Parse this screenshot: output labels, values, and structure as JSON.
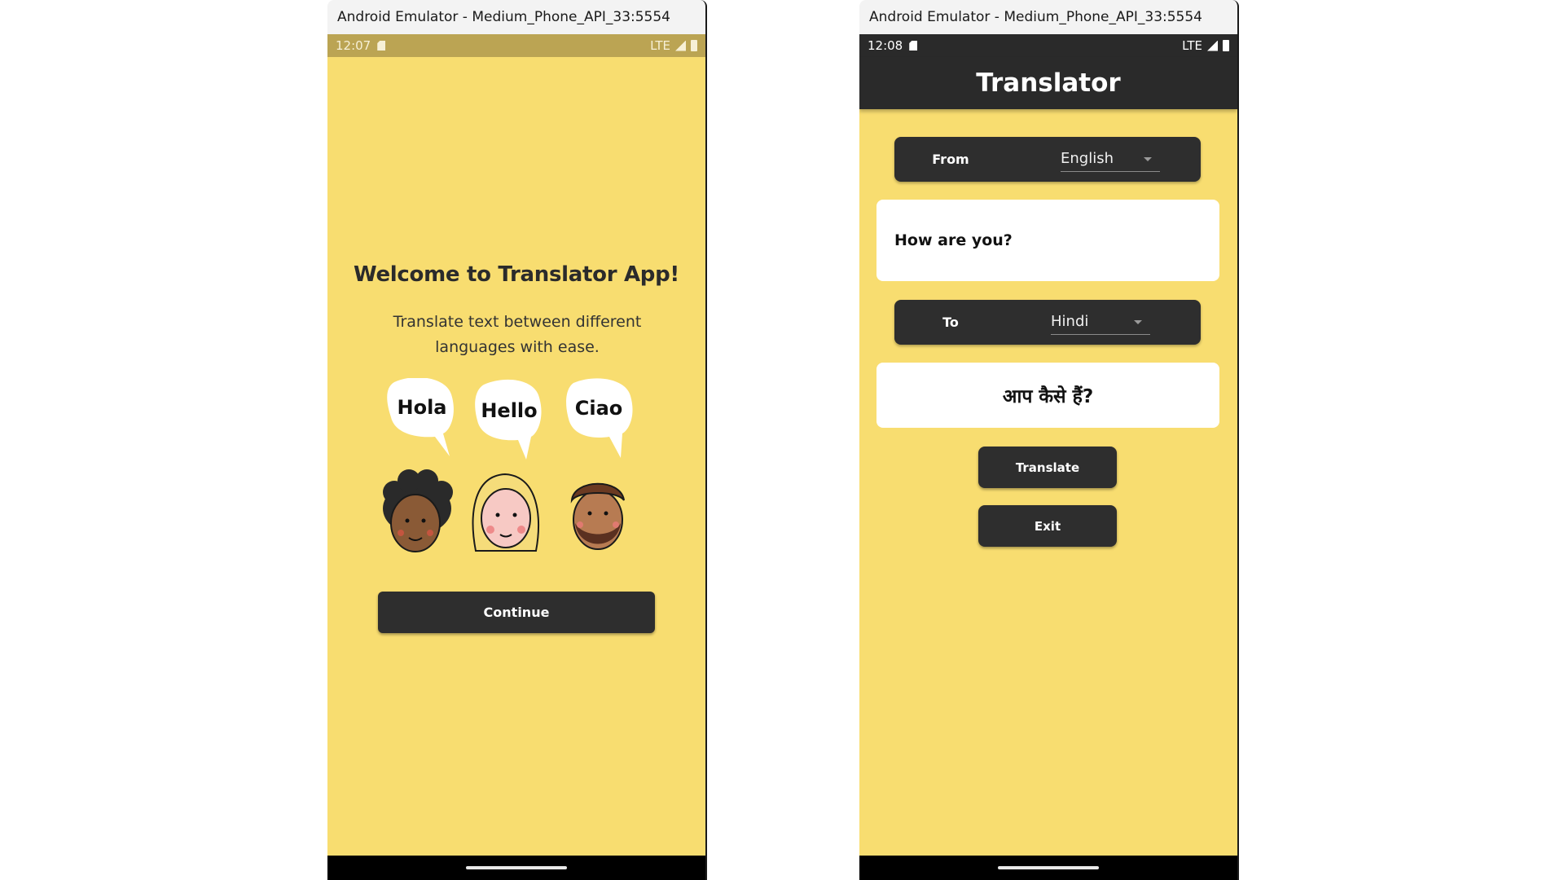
{
  "left_window": {
    "title": "Android Emulator - Medium_Phone_API_33:5554",
    "status": {
      "time": "12:07",
      "network": "LTE"
    },
    "welcome_title": "Welcome to Translator App!",
    "welcome_subtitle": "Translate text between different languages with ease.",
    "illustration": {
      "bubble_1": "Hola",
      "bubble_2": "Hello",
      "bubble_3": "Ciao"
    },
    "continue_label": "Continue"
  },
  "right_window": {
    "title": "Android Emulator - Medium_Phone_API_33:5554",
    "status": {
      "time": "12:08",
      "network": "LTE"
    },
    "app_title": "Translator",
    "from": {
      "label": "From",
      "value": "English"
    },
    "input_text": "How are you?",
    "to": {
      "label": "To",
      "value": "Hindi"
    },
    "output_text": "आप कैसे हैं?",
    "translate_label": "Translate",
    "exit_label": "Exit"
  },
  "colors": {
    "background_yellow": "#f8dd70",
    "dark": "#2e2e2e",
    "left_status_bar": "#bba453",
    "right_status_bar": "#2a2a2a"
  }
}
